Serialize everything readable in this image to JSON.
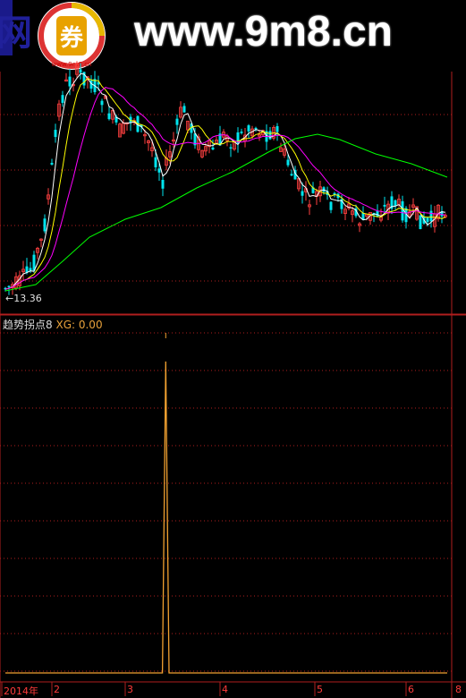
{
  "watermark": {
    "site_text": "www.9m8.cn",
    "logo_text": "www.9m8.cn",
    "left_fragment": "网"
  },
  "price_panel": {
    "low_marker": "13.36"
  },
  "indicator_panel": {
    "name": "趋势拐点8",
    "series_label": "XG:",
    "series_value": "0.00"
  },
  "x_axis": {
    "labels": [
      "2014年",
      "2",
      "3",
      "4",
      "5",
      "6"
    ],
    "right_stub": "8"
  },
  "colors": {
    "up": "#ff4040",
    "down": "#00e5ee",
    "grid": "#b01e1e",
    "ma5": "#ffffff",
    "ma10": "#ffff00",
    "ma20": "#ff00ff",
    "ma60": "#00ff00",
    "indicator": "#f0a030"
  },
  "chart_data": {
    "type": "line",
    "title": "",
    "series": [
      {
        "name": "XG",
        "values": [
          0,
          0,
          0,
          0,
          0,
          0,
          0,
          0,
          0,
          0,
          0,
          0,
          0,
          0,
          0,
          0,
          0,
          0,
          0,
          0,
          0,
          0,
          0,
          0,
          0,
          0,
          0,
          0,
          0,
          0,
          0,
          0,
          0,
          0,
          0,
          0,
          0,
          0,
          0,
          0,
          0,
          0,
          0,
          0,
          0,
          0,
          0,
          0,
          0,
          1,
          0,
          0,
          0,
          0,
          0,
          0,
          0,
          0,
          0,
          0,
          0,
          0,
          0,
          0,
          0,
          0,
          0,
          0,
          0,
          0,
          0,
          0,
          0,
          0,
          0,
          0,
          0,
          0,
          0,
          0,
          0,
          0,
          0,
          0,
          0,
          0,
          0,
          0,
          0,
          0,
          0,
          0,
          0,
          0,
          0,
          0,
          0,
          0,
          0,
          0,
          0,
          0,
          0,
          0,
          0,
          0,
          0,
          0,
          0,
          0,
          0,
          0,
          0,
          0,
          0,
          0,
          0,
          0,
          0,
          0,
          0,
          0,
          0,
          0,
          0,
          0,
          0,
          0,
          0,
          0,
          0,
          0,
          0,
          0,
          0,
          0
        ]
      }
    ],
    "ylim": [
      0,
      1
    ]
  }
}
